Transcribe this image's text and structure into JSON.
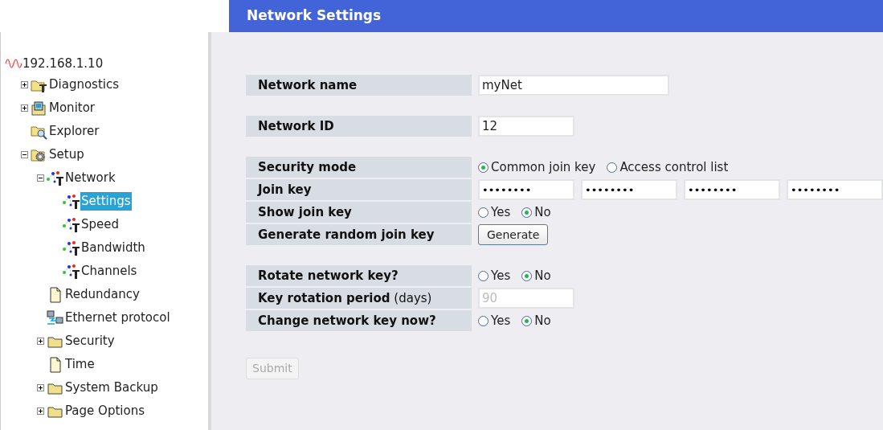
{
  "header": {
    "title": "Network Settings"
  },
  "tree": {
    "root": {
      "label": "192.168.1.10",
      "kind": "signal"
    },
    "items": [
      {
        "label": "Diagnostics",
        "kind": "toolfolder",
        "expanded": false,
        "selected": false
      },
      {
        "label": "Monitor",
        "kind": "monitor",
        "expanded": false,
        "selected": false
      },
      {
        "label": "Explorer",
        "kind": "explorer",
        "selected": false
      },
      {
        "label": "Setup",
        "kind": "setup",
        "expanded": true,
        "selected": false,
        "children": [
          {
            "label": "Network",
            "kind": "network",
            "expanded": true,
            "selected": false,
            "children": [
              {
                "label": "Settings",
                "kind": "network",
                "selected": true
              },
              {
                "label": "Speed",
                "kind": "network",
                "selected": false
              },
              {
                "label": "Bandwidth",
                "kind": "network",
                "selected": false
              },
              {
                "label": "Channels",
                "kind": "network",
                "selected": false
              }
            ]
          },
          {
            "label": "Redundancy",
            "kind": "page",
            "selected": false
          },
          {
            "label": "Ethernet protocol",
            "kind": "ethernet",
            "selected": false
          },
          {
            "label": "Security",
            "kind": "folder",
            "expanded": false,
            "selected": false
          },
          {
            "label": "Time",
            "kind": "page",
            "selected": false
          },
          {
            "label": "System Backup",
            "kind": "folder",
            "expanded": false,
            "selected": false
          },
          {
            "label": "Page Options",
            "kind": "folder",
            "expanded": false,
            "selected": false
          }
        ]
      }
    ]
  },
  "form": {
    "groups": [
      [
        {
          "label": "Network name",
          "kind": "longtext",
          "value": "myNet",
          "disabled": false
        }
      ],
      [
        {
          "label": "Network ID",
          "kind": "text",
          "value": "12",
          "disabled": false
        }
      ],
      [
        {
          "label": "Security mode",
          "kind": "radio",
          "options": [
            {
              "label": "Common join key",
              "selected": true
            },
            {
              "label": "Access control list",
              "selected": false
            }
          ]
        },
        {
          "label": "Join key",
          "kind": "keys",
          "values": [
            "••••••••",
            "••••••••",
            "••••••••",
            "••••••••"
          ]
        },
        {
          "label": "Show join key",
          "kind": "radio",
          "options": [
            {
              "label": "Yes",
              "selected": false
            },
            {
              "label": "No",
              "selected": true
            }
          ]
        },
        {
          "label": "Generate random join key",
          "kind": "button",
          "button": "Generate"
        }
      ],
      [
        {
          "label": "Rotate network key?",
          "kind": "radio",
          "options": [
            {
              "label": "Yes",
              "selected": false
            },
            {
              "label": "No",
              "selected": true
            }
          ]
        },
        {
          "label": "Key rotation period",
          "note": "(days)",
          "kind": "text",
          "value": "90",
          "disabled": true
        },
        {
          "label": "Change network key now?",
          "kind": "radio",
          "options": [
            {
              "label": "Yes",
              "selected": false
            },
            {
              "label": "No",
              "selected": true
            }
          ]
        }
      ]
    ],
    "submit": {
      "label": "Submit",
      "disabled": true
    }
  }
}
